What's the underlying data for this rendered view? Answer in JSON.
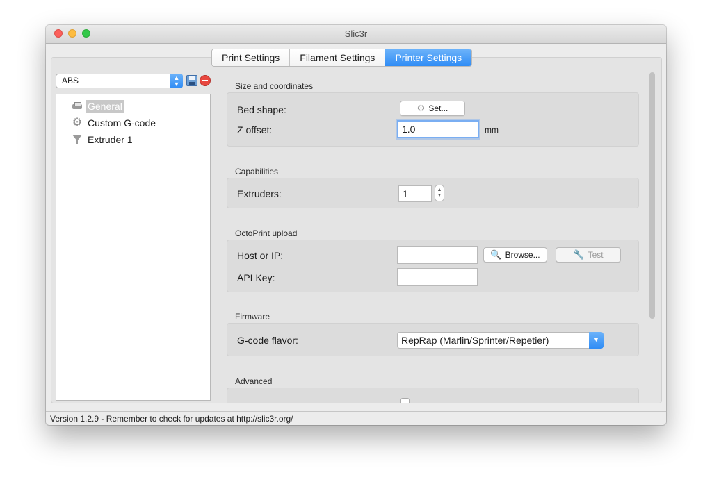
{
  "window": {
    "title": "Slic3r"
  },
  "tabs": [
    {
      "label": "Print Settings",
      "active": false
    },
    {
      "label": "Filament Settings",
      "active": false
    },
    {
      "label": "Printer Settings",
      "active": true
    }
  ],
  "preset": {
    "selected": "ABS",
    "save_icon": "save-icon",
    "delete_icon": "delete-icon"
  },
  "tree": [
    {
      "label": "General",
      "icon": "printer-icon",
      "selected": true
    },
    {
      "label": "Custom G-code",
      "icon": "gear-icon",
      "selected": false
    },
    {
      "label": "Extruder 1",
      "icon": "funnel-icon",
      "selected": false
    }
  ],
  "sections": {
    "size": {
      "title": "Size and coordinates",
      "bed_shape_label": "Bed shape:",
      "bed_shape_button": "Set...",
      "z_offset_label": "Z offset:",
      "z_offset_value": "1.0",
      "z_offset_unit": "mm"
    },
    "capabilities": {
      "title": "Capabilities",
      "extruders_label": "Extruders:",
      "extruders_value": "1"
    },
    "octoprint": {
      "title": "OctoPrint upload",
      "host_label": "Host or IP:",
      "host_value": "",
      "browse_button": "Browse...",
      "test_button": "Test",
      "api_key_label": "API Key:",
      "api_key_value": ""
    },
    "firmware": {
      "title": "Firmware",
      "gcode_flavor_label": "G-code flavor:",
      "gcode_flavor_value": "RepRap (Marlin/Sprinter/Repetier)"
    },
    "advanced": {
      "title": "Advanced",
      "use_relative_e_checked": false
    }
  },
  "status": {
    "text": "Version 1.2.9 - Remember to check for updates at http://slic3r.org/"
  },
  "colors": {
    "accent": "#2f8cf5",
    "focus_ring": "#7aaef2"
  }
}
